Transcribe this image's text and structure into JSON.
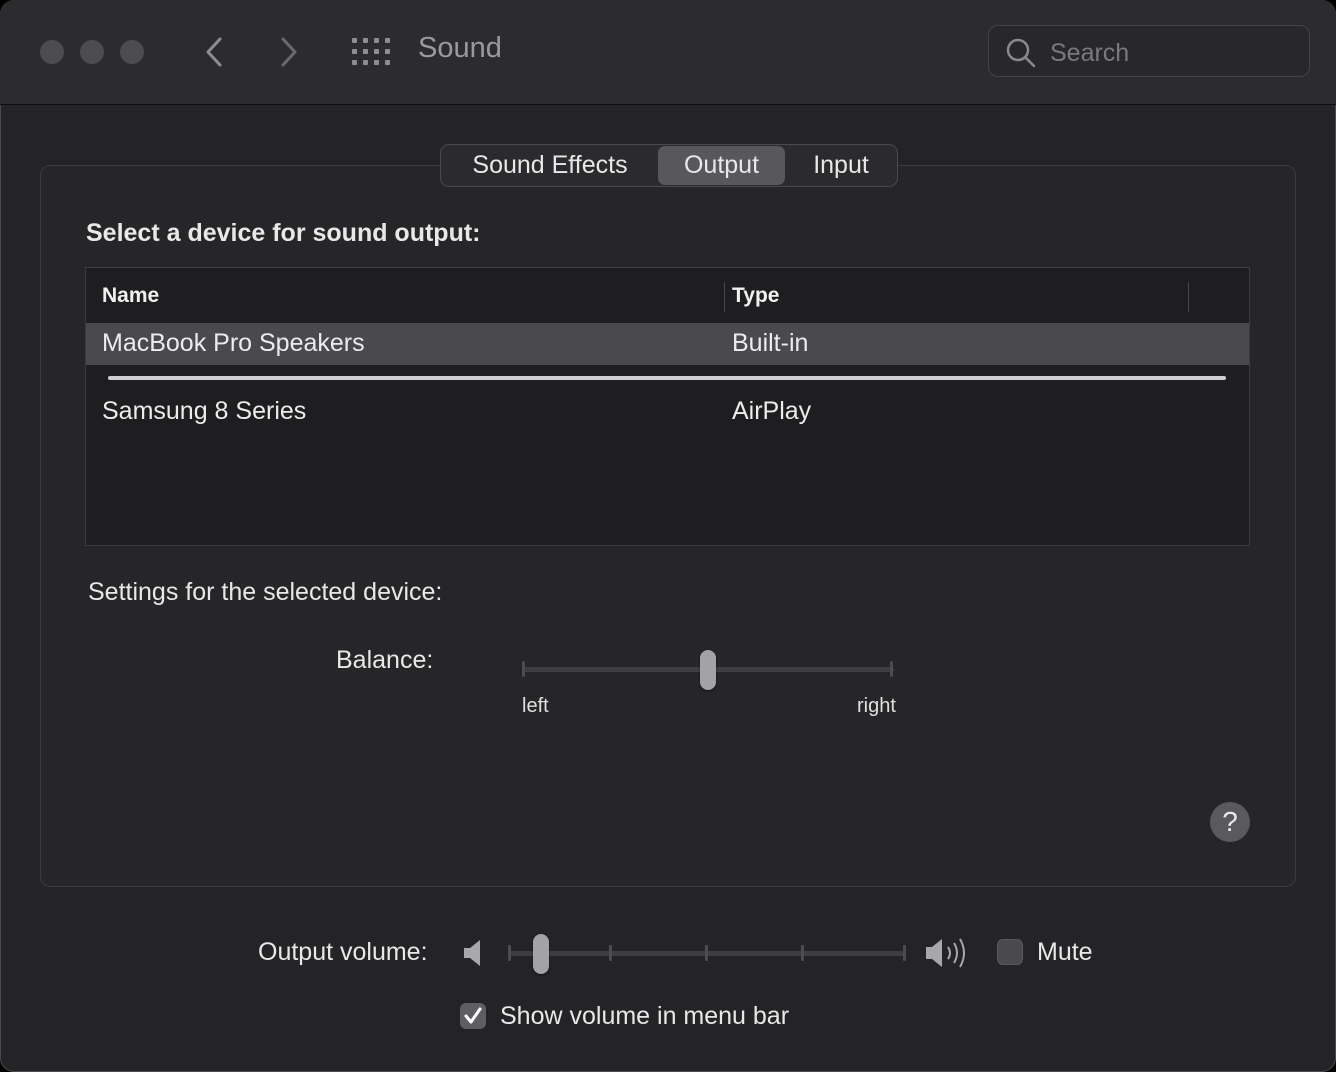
{
  "window": {
    "title": "Sound",
    "search_placeholder": "Search"
  },
  "tabs": [
    {
      "label": "Sound Effects",
      "active": false
    },
    {
      "label": "Output",
      "active": true
    },
    {
      "label": "Input",
      "active": false
    }
  ],
  "output": {
    "heading": "Select a device for sound output:",
    "columns": {
      "name": "Name",
      "type": "Type"
    },
    "devices": [
      {
        "name": "MacBook Pro Speakers",
        "type": "Built-in",
        "selected": true
      },
      {
        "name": "Samsung 8 Series",
        "type": "AirPlay",
        "selected": false
      }
    ],
    "settings_heading": "Settings for the selected device:",
    "balance": {
      "label": "Balance:",
      "left_label": "left",
      "right_label": "right",
      "value": 0.5
    }
  },
  "volume": {
    "label": "Output volume:",
    "value": 0.08,
    "mute_label": "Mute",
    "mute_checked": false,
    "show_in_menu_bar_label": "Show volume in menu bar",
    "show_in_menu_bar_checked": true
  },
  "help": {
    "glyph": "?"
  },
  "colors": {
    "window_bg": "#242427",
    "selected_row": "#4a4a4e",
    "active_tab": "#58585c"
  }
}
